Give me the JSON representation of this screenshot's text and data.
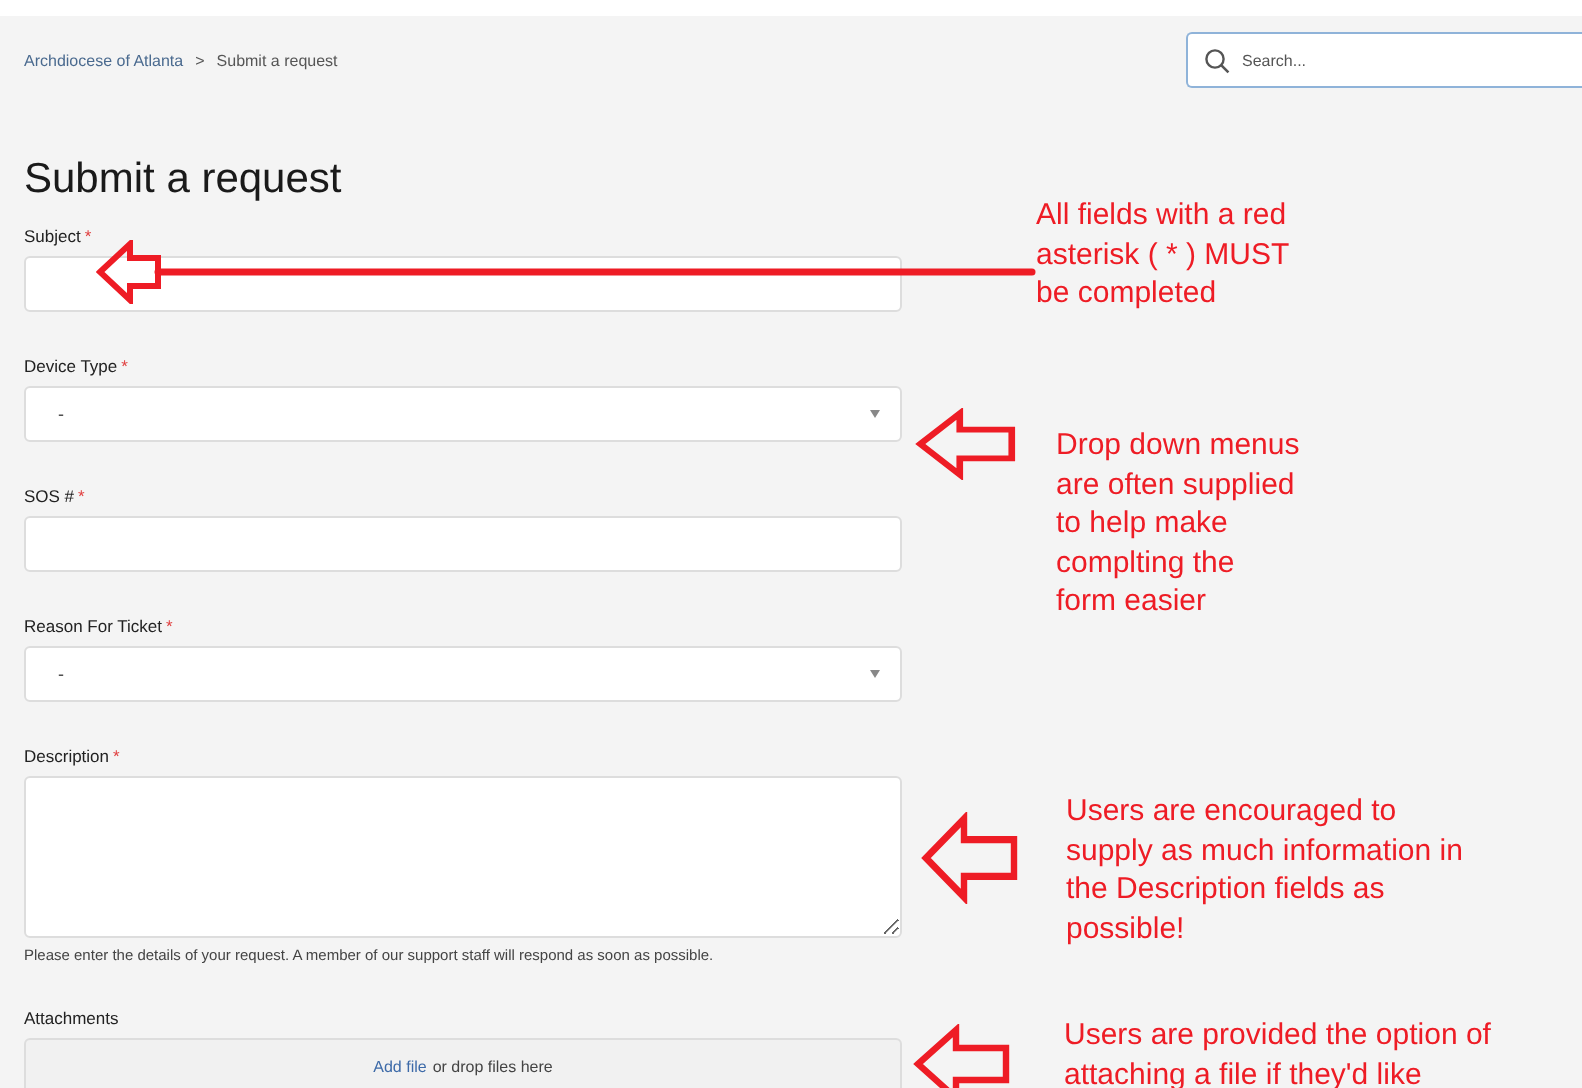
{
  "breadcrumb": [
    {
      "label": "Archdiocese of Atlanta",
      "kind": "link"
    },
    {
      "label": ">",
      "kind": "separator"
    },
    {
      "label": "Submit a request",
      "kind": "current"
    }
  ],
  "search": {
    "placeholder": "Search..."
  },
  "title": "Submit a request",
  "required_mark": "*",
  "fields": [
    {
      "label": "Subject",
      "required": true,
      "kind": "text"
    },
    {
      "label": "Device Type",
      "required": true,
      "kind": "select",
      "value": "-"
    },
    {
      "label": "SOS #",
      "required": true,
      "kind": "text"
    },
    {
      "label": "Reason For Ticket",
      "required": true,
      "kind": "select",
      "value": "-"
    },
    {
      "label": "Description",
      "required": true,
      "kind": "textarea",
      "help": "Please enter the details of your request. A member of our support staff will respond as soon as possible."
    },
    {
      "label": "Attachments",
      "required": false,
      "kind": "attachments",
      "link": "Add file",
      "text": "or drop files here"
    }
  ],
  "annotations": [
    {
      "kind": "long",
      "lines": [
        "All fields with a red",
        "asterisk ( * ) MUST",
        "be completed"
      ]
    },
    {
      "kind": "short",
      "lines": [
        "Drop down menus",
        "are often supplied",
        "to help make",
        "complting the",
        "form easier"
      ]
    },
    {
      "kind": "short",
      "lines": [
        "Users are encouraged to",
        "supply as much information in",
        "the Description fields as",
        "possible!"
      ]
    },
    {
      "kind": "short",
      "lines": [
        "Users are provided the option of",
        "attaching a file if they'd like"
      ]
    }
  ]
}
